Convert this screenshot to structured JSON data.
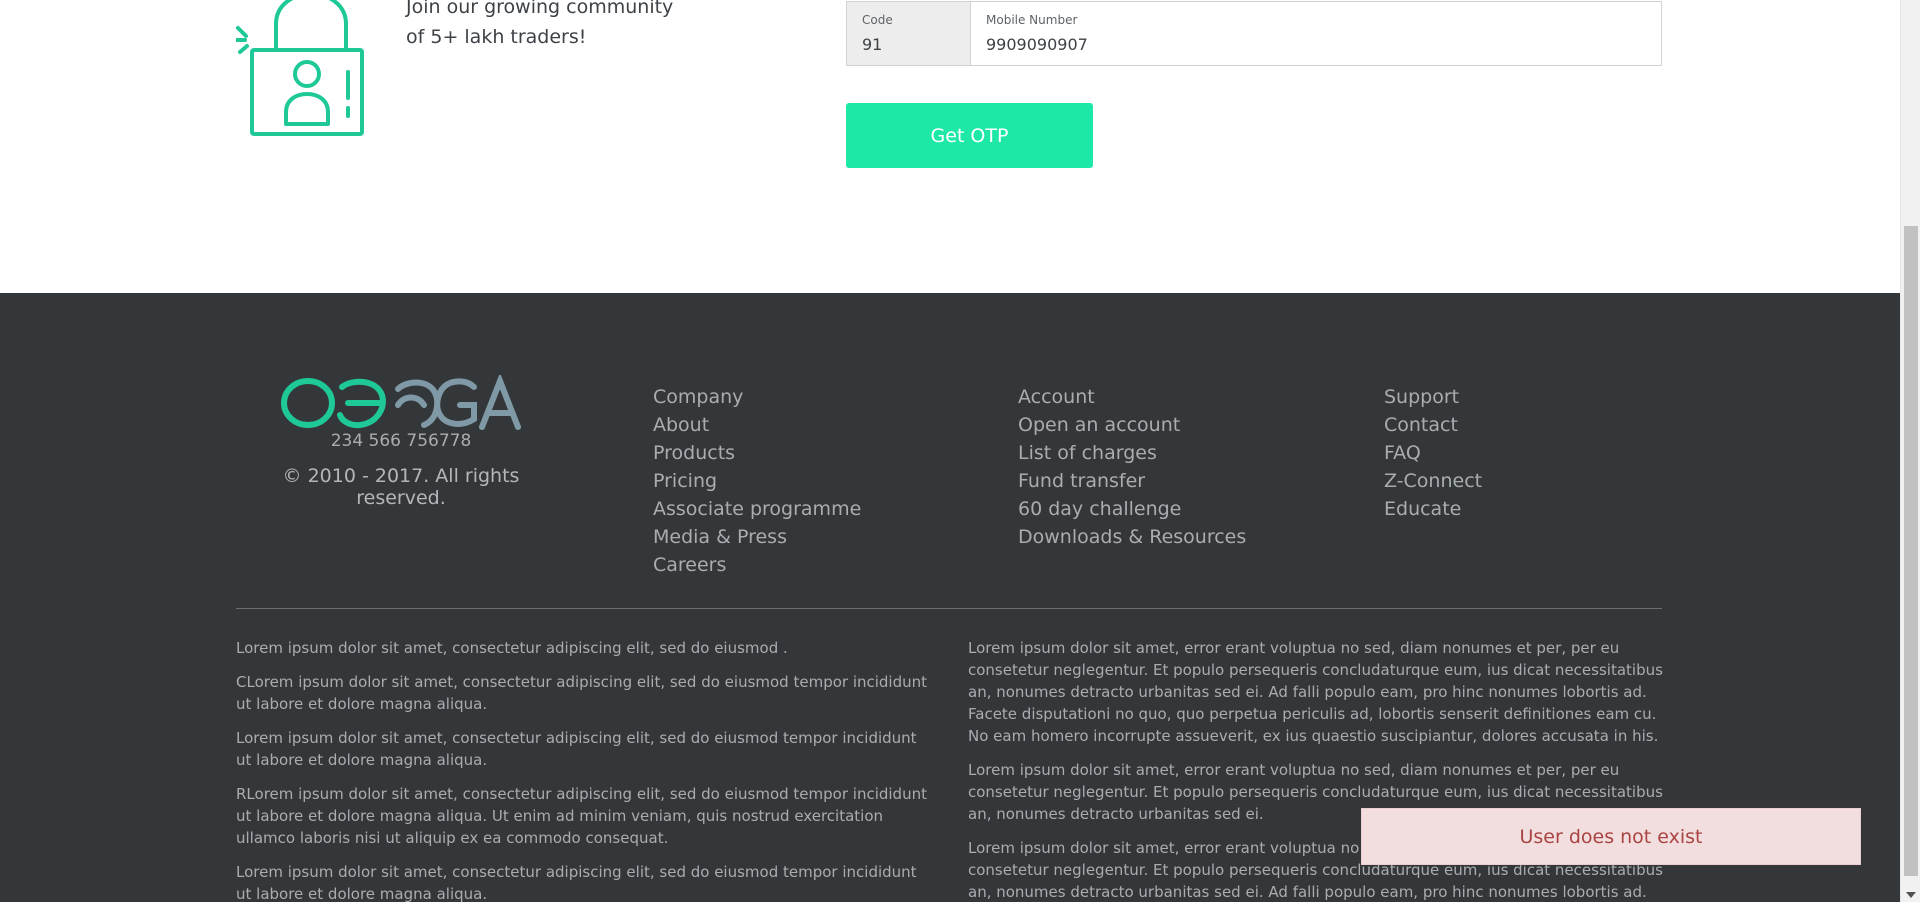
{
  "signup": {
    "community_line1": "Join our growing community",
    "community_line2": "of 5+ lakh traders!",
    "code_label": "Code",
    "code_value": "91",
    "mobile_label": "Mobile Number",
    "mobile_value": "9909090907",
    "otp_button": "Get OTP"
  },
  "footer": {
    "brand_phone": "234 566 756778",
    "copyright": "© 2010 - 2017. All rights reserved.",
    "columns": [
      {
        "items": [
          "Company",
          "About",
          "Products",
          "Pricing",
          "Associate programme",
          "Media & Press",
          "Careers"
        ]
      },
      {
        "items": [
          "Account",
          "Open an account",
          "List of charges",
          "Fund transfer",
          "60 day challenge",
          "Downloads & Resources"
        ]
      },
      {
        "items": [
          "Support",
          "Contact",
          "FAQ",
          "Z-Connect",
          "Educate"
        ]
      }
    ],
    "legal_left": [
      "Lorem ipsum dolor sit amet, consectetur adipiscing elit, sed do eiusmod .",
      "CLorem ipsum dolor sit amet, consectetur adipiscing elit, sed do eiusmod tempor incididunt ut labore et dolore magna aliqua.",
      "Lorem ipsum dolor sit amet, consectetur adipiscing elit, sed do eiusmod tempor incididunt ut labore et dolore magna aliqua.",
      "RLorem ipsum dolor sit amet, consectetur adipiscing elit, sed do eiusmod tempor incididunt ut labore et dolore magna aliqua. Ut enim ad minim veniam, quis nostrud exercitation ullamco laboris nisi ut aliquip ex ea commodo consequat.",
      "Lorem ipsum dolor sit amet, consectetur adipiscing elit, sed do eiusmod tempor incididunt ut labore et dolore magna aliqua."
    ],
    "legal_right": [
      "Lorem ipsum dolor sit amet, error erant voluptua no sed, diam nonumes et per, per eu consetetur neglegentur. Et populo persequeris concludaturque eum, ius dicat necessitatibus an, nonumes detracto urbanitas sed ei. Ad falli populo eam, pro hinc nonumes lobortis ad. Facete disputationi no quo, quo perpetua periculis ad, lobortis senserit definitiones eam cu. No eam homero incorrupte assueverit, ex ius quaestio suscipiantur, dolores accusata in his.",
      "Lorem ipsum dolor sit amet, error erant voluptua no sed, diam nonumes et per, per eu consetetur neglegentur. Et populo persequeris concludaturque eum, ius dicat necessitatibus an, nonumes detracto urbanitas sed ei.",
      "Lorem ipsum dolor sit amet, error erant voluptua no sed, diam nonumes et per, per eu consetetur neglegentur. Et populo persequeris concludaturque eum, ius dicat necessitatibus an, nonumes detracto urbanitas sed ei. Ad falli populo eam, pro hinc nonumes lobortis ad."
    ]
  },
  "toast": {
    "message": "User does not exist"
  },
  "colors": {
    "accent": "#1ee8a8",
    "logo_green": "#1ec997",
    "footer_bg": "#343739",
    "toast_bg": "#f2dede",
    "toast_text": "#a94442"
  },
  "icons": [
    "lock-user-icon",
    "omega-logo"
  ]
}
